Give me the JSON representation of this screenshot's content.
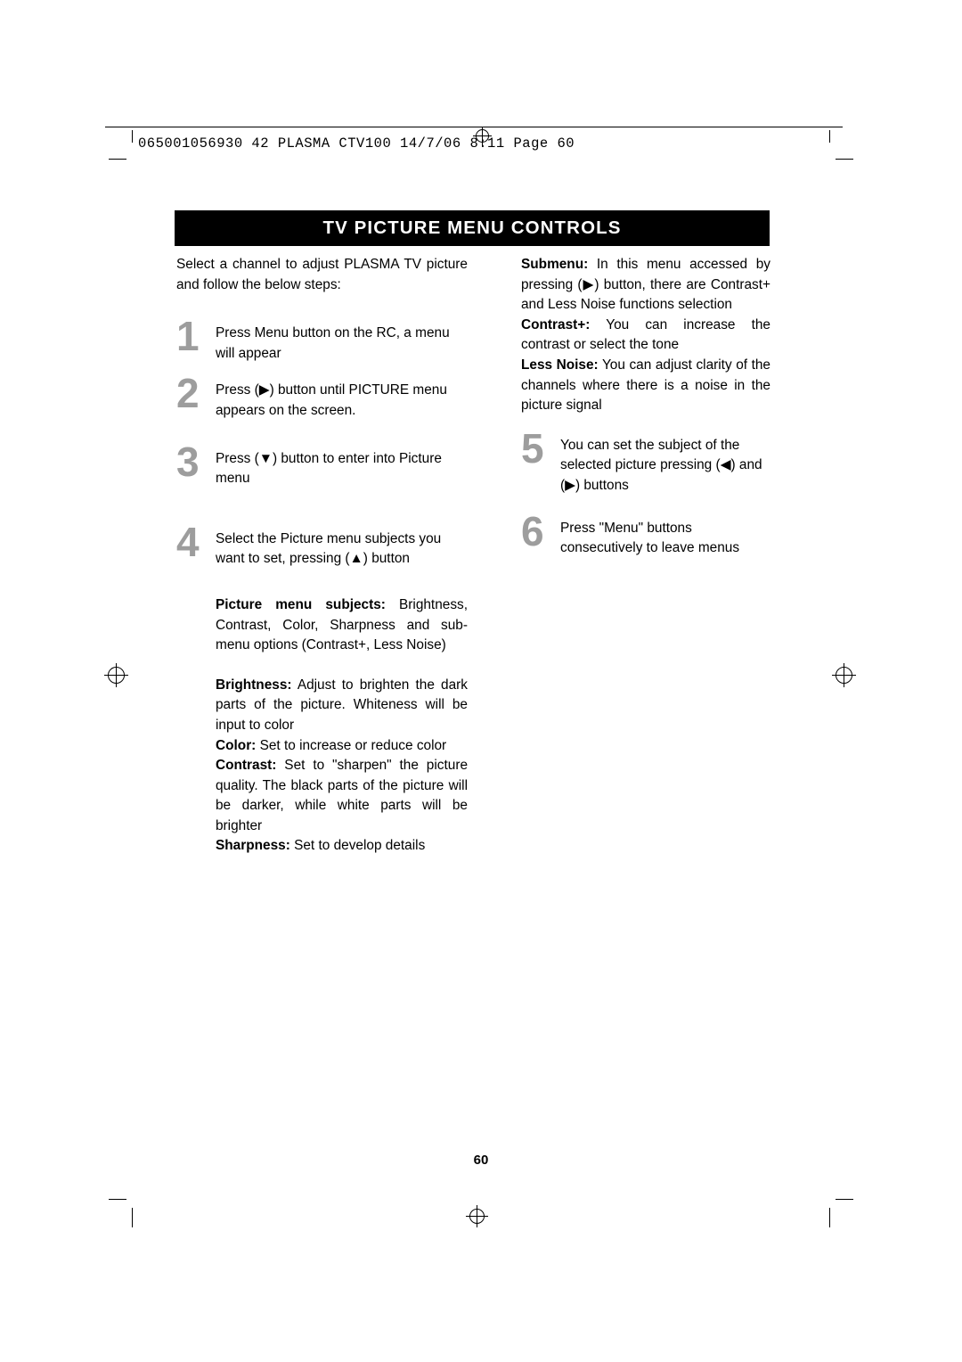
{
  "slug": {
    "text": "065001056930 42 PLASMA CTV100  14/7/06  8:11   Page  60"
  },
  "title": "TV PICTURE MENU CONTROLS",
  "left_column": {
    "intro": "Select a channel to adjust PLASMA TV picture and follow the below steps:",
    "steps": [
      {
        "num": "1",
        "text": "Press Menu button on the RC, a menu will appear"
      },
      {
        "num": "2",
        "text": "Press  (▶) button until PICTURE menu appears on the screen."
      },
      {
        "num": "3",
        "text": "Press (▼) button to enter into Picture menu"
      },
      {
        "num": "4",
        "text": "Select the Picture menu subjects you want to set, pressing (▲) button"
      }
    ],
    "subjects_label": "Picture menu subjects:",
    "subjects_text": " Brightness, Contrast, Color, Sharpness and sub-menu options (Contrast+, Less Noise)",
    "definitions": [
      {
        "term": "Brightness:",
        "text": " Adjust to brighten the dark parts of the picture. Whiteness will be input to color"
      },
      {
        "term": "Color:",
        "text": " Set to increase or reduce color"
      },
      {
        "term": "Contrast:",
        "text": " Set to \"sharpen\" the picture quality. The black parts of the picture will be darker, while white parts will be brighter"
      },
      {
        "term": "Sharpness:",
        "text": " Set to develop details"
      }
    ]
  },
  "right_column": {
    "submenu_label": "Submenu:",
    "submenu_text": "  In  this  menu  accessed  by pressing  (▶)  button,  there  are Contrast+  and  Less  Noise  functions selection",
    "contrast_label": "Contrast+:",
    "contrast_text": "  You  can  increase  the  contrast or  select the tone",
    "lessnoise_label": "Less Noise:",
    "lessnoise_text": " You can adjust clarity of the channels where there is a noise in the picture signal",
    "steps": [
      {
        "num": "5",
        "text": "You can set the subject of the selected picture pressing (◀) and (▶) buttons"
      },
      {
        "num": "6",
        "text": "Press \"Menu\" buttons consecutively to leave menus"
      }
    ]
  },
  "page_number": "60"
}
